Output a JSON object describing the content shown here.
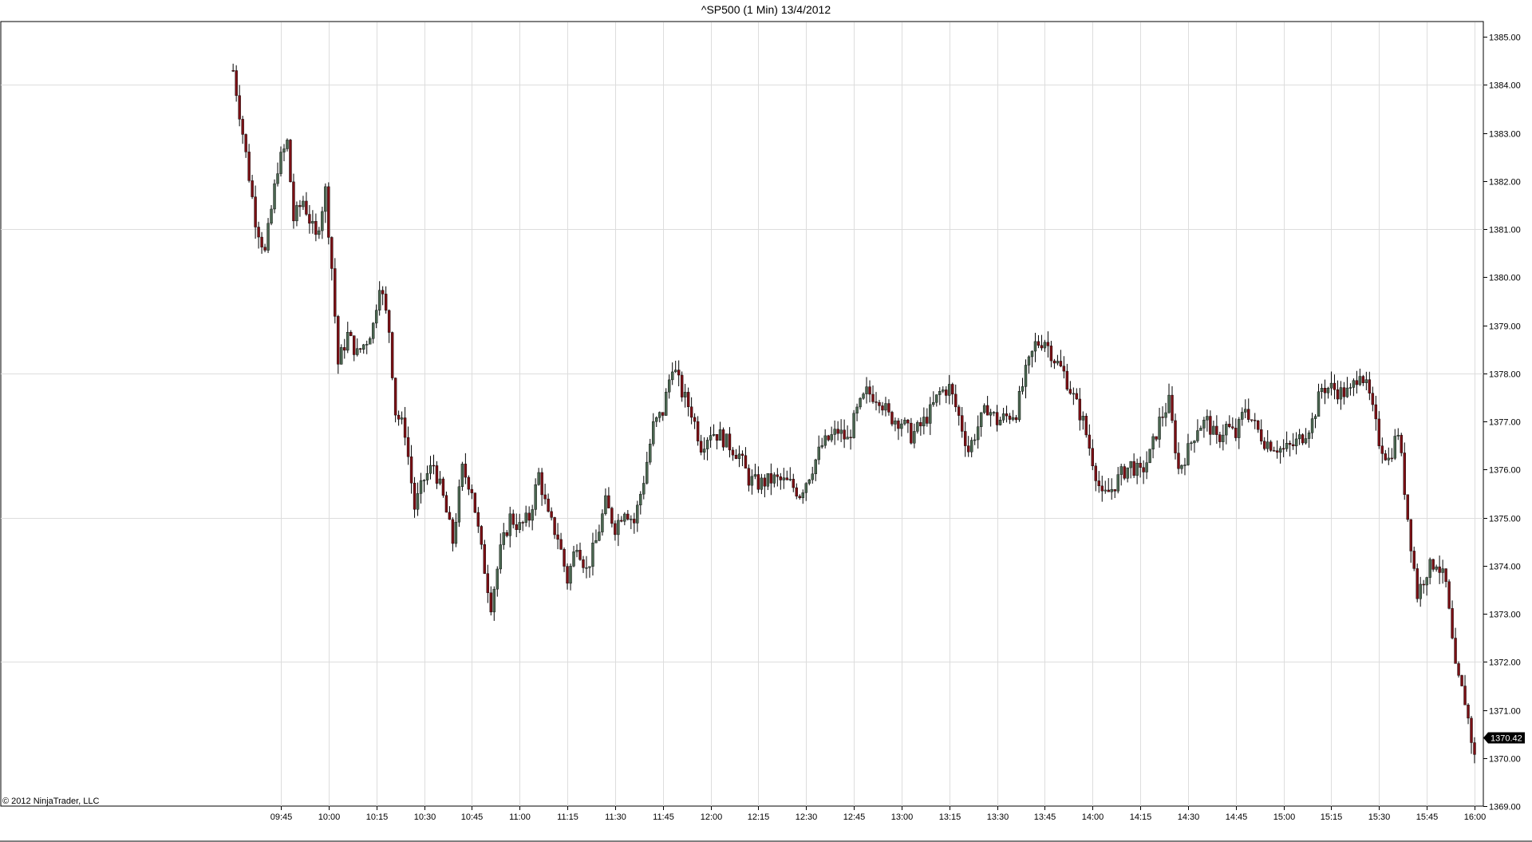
{
  "chart_data": {
    "type": "candlestick",
    "title": "^SP500 (1 Min)  13/4/2012",
    "copyright": "© 2012 NinjaTrader, LLC",
    "ylim": [
      1369.0,
      1385.3
    ],
    "y_ticks": [
      "1369.00",
      "1370.00",
      "1371.00",
      "1372.00",
      "1373.00",
      "1374.00",
      "1375.00",
      "1376.00",
      "1377.00",
      "1378.00",
      "1379.00",
      "1380.00",
      "1381.00",
      "1382.00",
      "1383.00",
      "1384.00",
      "1385.00"
    ],
    "x_range": [
      "09:30",
      "16:00"
    ],
    "x_ticks": [
      "09:45",
      "10:00",
      "10:15",
      "10:30",
      "10:45",
      "11:00",
      "11:15",
      "11:30",
      "11:45",
      "12:00",
      "12:15",
      "12:30",
      "12:45",
      "13:00",
      "13:15",
      "13:30",
      "13:45",
      "14:00",
      "14:15",
      "14:30",
      "14:45",
      "15:00",
      "15:15",
      "15:30",
      "15:45",
      "16:00"
    ],
    "grid": true,
    "last_price": "1370.42",
    "colors": {
      "up": "#4a6650",
      "down": "#7a0f14",
      "grid": "#dddddd",
      "axis": "#000000"
    },
    "price_path": [
      [
        "09:30",
        1384.3
      ],
      [
        "09:33",
        1383.0
      ],
      [
        "09:37",
        1381.2
      ],
      [
        "09:40",
        1380.5
      ],
      [
        "09:44",
        1382.3
      ],
      [
        "09:47",
        1382.8
      ],
      [
        "09:49",
        1381.2
      ],
      [
        "09:52",
        1381.6
      ],
      [
        "09:56",
        1380.8
      ],
      [
        "09:59",
        1381.8
      ],
      [
        "10:01",
        1380.2
      ],
      [
        "10:03",
        1378.2
      ],
      [
        "10:06",
        1378.8
      ],
      [
        "10:09",
        1378.4
      ],
      [
        "10:12",
        1378.7
      ],
      [
        "10:14",
        1379.0
      ],
      [
        "10:16",
        1379.9
      ],
      [
        "10:19",
        1378.9
      ],
      [
        "10:21",
        1377.2
      ],
      [
        "10:24",
        1376.8
      ],
      [
        "10:27",
        1375.2
      ],
      [
        "10:30",
        1375.8
      ],
      [
        "10:33",
        1376.1
      ],
      [
        "10:36",
        1375.4
      ],
      [
        "10:39",
        1374.5
      ],
      [
        "10:42",
        1376.0
      ],
      [
        "10:45",
        1375.6
      ],
      [
        "10:48",
        1374.3
      ],
      [
        "10:51",
        1373.2
      ],
      [
        "10:54",
        1374.3
      ],
      [
        "10:57",
        1375.0
      ],
      [
        "11:00",
        1374.8
      ],
      [
        "11:03",
        1375.0
      ],
      [
        "11:06",
        1375.9
      ],
      [
        "11:09",
        1375.0
      ],
      [
        "11:12",
        1374.6
      ],
      [
        "11:15",
        1373.7
      ],
      [
        "11:18",
        1374.5
      ],
      [
        "11:21",
        1373.9
      ],
      [
        "11:24",
        1374.5
      ],
      [
        "11:27",
        1375.3
      ],
      [
        "11:30",
        1374.8
      ],
      [
        "11:33",
        1375.2
      ],
      [
        "11:36",
        1374.9
      ],
      [
        "11:39",
        1375.8
      ],
      [
        "11:42",
        1376.9
      ],
      [
        "11:45",
        1377.2
      ],
      [
        "11:48",
        1378.2
      ],
      [
        "11:51",
        1377.6
      ],
      [
        "11:54",
        1377.2
      ],
      [
        "11:57",
        1376.5
      ],
      [
        "12:00",
        1376.8
      ],
      [
        "12:03",
        1376.7
      ],
      [
        "12:06",
        1376.5
      ],
      [
        "12:09",
        1376.3
      ],
      [
        "12:12",
        1375.8
      ],
      [
        "12:15",
        1375.7
      ],
      [
        "12:20",
        1375.8
      ],
      [
        "12:25",
        1375.7
      ],
      [
        "12:28",
        1375.5
      ],
      [
        "12:31",
        1375.9
      ],
      [
        "12:35",
        1376.5
      ],
      [
        "12:40",
        1376.8
      ],
      [
        "12:43",
        1376.6
      ],
      [
        "12:46",
        1377.2
      ],
      [
        "12:49",
        1377.6
      ],
      [
        "12:53",
        1377.5
      ],
      [
        "12:56",
        1377.1
      ],
      [
        "13:00",
        1377.0
      ],
      [
        "13:03",
        1376.7
      ],
      [
        "13:06",
        1376.9
      ],
      [
        "13:09",
        1377.2
      ],
      [
        "13:12",
        1377.6
      ],
      [
        "13:15",
        1377.7
      ],
      [
        "13:18",
        1377.1
      ],
      [
        "13:21",
        1376.4
      ],
      [
        "13:24",
        1376.9
      ],
      [
        "13:27",
        1377.3
      ],
      [
        "13:30",
        1377.0
      ],
      [
        "13:33",
        1377.1
      ],
      [
        "13:36",
        1377.2
      ],
      [
        "13:39",
        1378.0
      ],
      [
        "13:42",
        1378.6
      ],
      [
        "13:45",
        1378.7
      ],
      [
        "13:48",
        1378.3
      ],
      [
        "13:51",
        1378.0
      ],
      [
        "13:54",
        1377.5
      ],
      [
        "13:57",
        1377.0
      ],
      [
        "14:00",
        1376.2
      ],
      [
        "14:03",
        1375.4
      ],
      [
        "14:06",
        1375.6
      ],
      [
        "14:09",
        1375.9
      ],
      [
        "14:12",
        1376.1
      ],
      [
        "14:15",
        1375.9
      ],
      [
        "14:18",
        1376.3
      ],
      [
        "14:21",
        1377.0
      ],
      [
        "14:24",
        1377.4
      ],
      [
        "14:27",
        1376.0
      ],
      [
        "14:30",
        1376.4
      ],
      [
        "14:33",
        1376.9
      ],
      [
        "14:36",
        1377.0
      ],
      [
        "14:39",
        1376.6
      ],
      [
        "14:42",
        1376.9
      ],
      [
        "14:45",
        1376.7
      ],
      [
        "14:48",
        1377.3
      ],
      [
        "14:51",
        1376.9
      ],
      [
        "14:54",
        1376.6
      ],
      [
        "14:57",
        1376.5
      ],
      [
        "15:00",
        1376.4
      ],
      [
        "15:03",
        1376.5
      ],
      [
        "15:06",
        1376.7
      ],
      [
        "15:09",
        1377.0
      ],
      [
        "15:12",
        1377.7
      ],
      [
        "15:15",
        1377.7
      ],
      [
        "15:18",
        1377.6
      ],
      [
        "15:21",
        1377.6
      ],
      [
        "15:24",
        1378.1
      ],
      [
        "15:27",
        1377.5
      ],
      [
        "15:30",
        1376.6
      ],
      [
        "15:33",
        1376.2
      ],
      [
        "15:36",
        1376.8
      ],
      [
        "15:39",
        1375.0
      ],
      [
        "15:42",
        1373.4
      ],
      [
        "15:45",
        1373.9
      ],
      [
        "15:48",
        1374.1
      ],
      [
        "15:51",
        1373.6
      ],
      [
        "15:54",
        1371.8
      ],
      [
        "15:57",
        1371.2
      ],
      [
        "16:00",
        1370.0
      ]
    ]
  }
}
